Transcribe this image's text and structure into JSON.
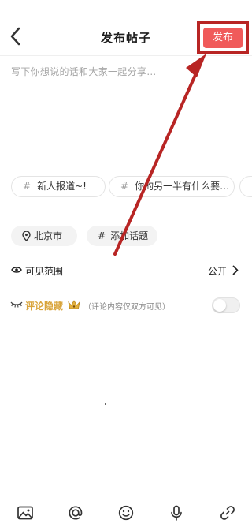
{
  "header": {
    "title": "发布帖子",
    "publish_label": "发布"
  },
  "editor": {
    "placeholder": "写下你想说的话和大家一起分享…"
  },
  "topic_chips": [
    {
      "label": "新人报道~!"
    },
    {
      "label": "你的另一半有什么要…"
    }
  ],
  "location": {
    "label": "北京市"
  },
  "add_topic": {
    "label": "添加话题"
  },
  "visibility": {
    "label": "可见范围",
    "value": "公开"
  },
  "comment_hide": {
    "label": "评论隐藏",
    "note": "（评论内容仅双方可见）",
    "enabled": false
  },
  "toolbar_icons": [
    "image-icon",
    "at-icon",
    "emoji-icon",
    "mic-icon",
    "link-icon"
  ],
  "colors": {
    "publish_bg": "#f05a5a",
    "highlight_frame": "#b82524",
    "gold": "#d9a43a"
  }
}
